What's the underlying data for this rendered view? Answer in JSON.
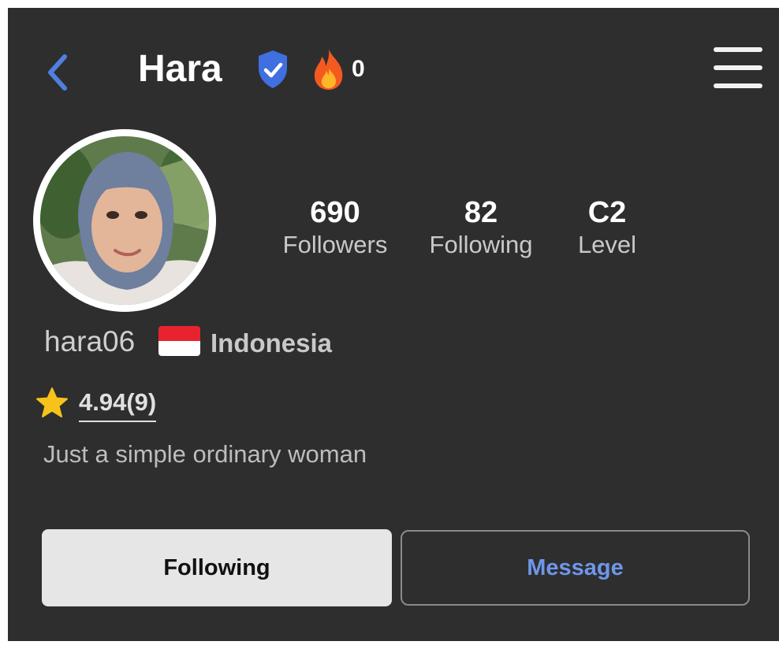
{
  "header": {
    "title": "Hara",
    "fire_count": "0",
    "icons": {
      "back": "chevron-left-icon",
      "verified": "verified-badge-icon",
      "fire": "fire-icon",
      "menu": "hamburger-menu-icon"
    }
  },
  "profile": {
    "avatar": "profile-photo",
    "username": "hara06",
    "country": "Indonesia",
    "flag": "indonesia-flag",
    "rating": "4.94(9)",
    "bio": "Just a simple ordinary woman"
  },
  "stats": [
    {
      "value": "690",
      "label": "Followers"
    },
    {
      "value": "82",
      "label": "Following"
    },
    {
      "value": "C2",
      "label": "Level"
    }
  ],
  "actions": {
    "following_label": "Following",
    "message_label": "Message"
  },
  "colors": {
    "background": "#2e2e2e",
    "accent_blue": "#4f7fe0",
    "message_text": "#6f96ea",
    "star": "#f7c21c",
    "fire": "#f45a1f"
  }
}
